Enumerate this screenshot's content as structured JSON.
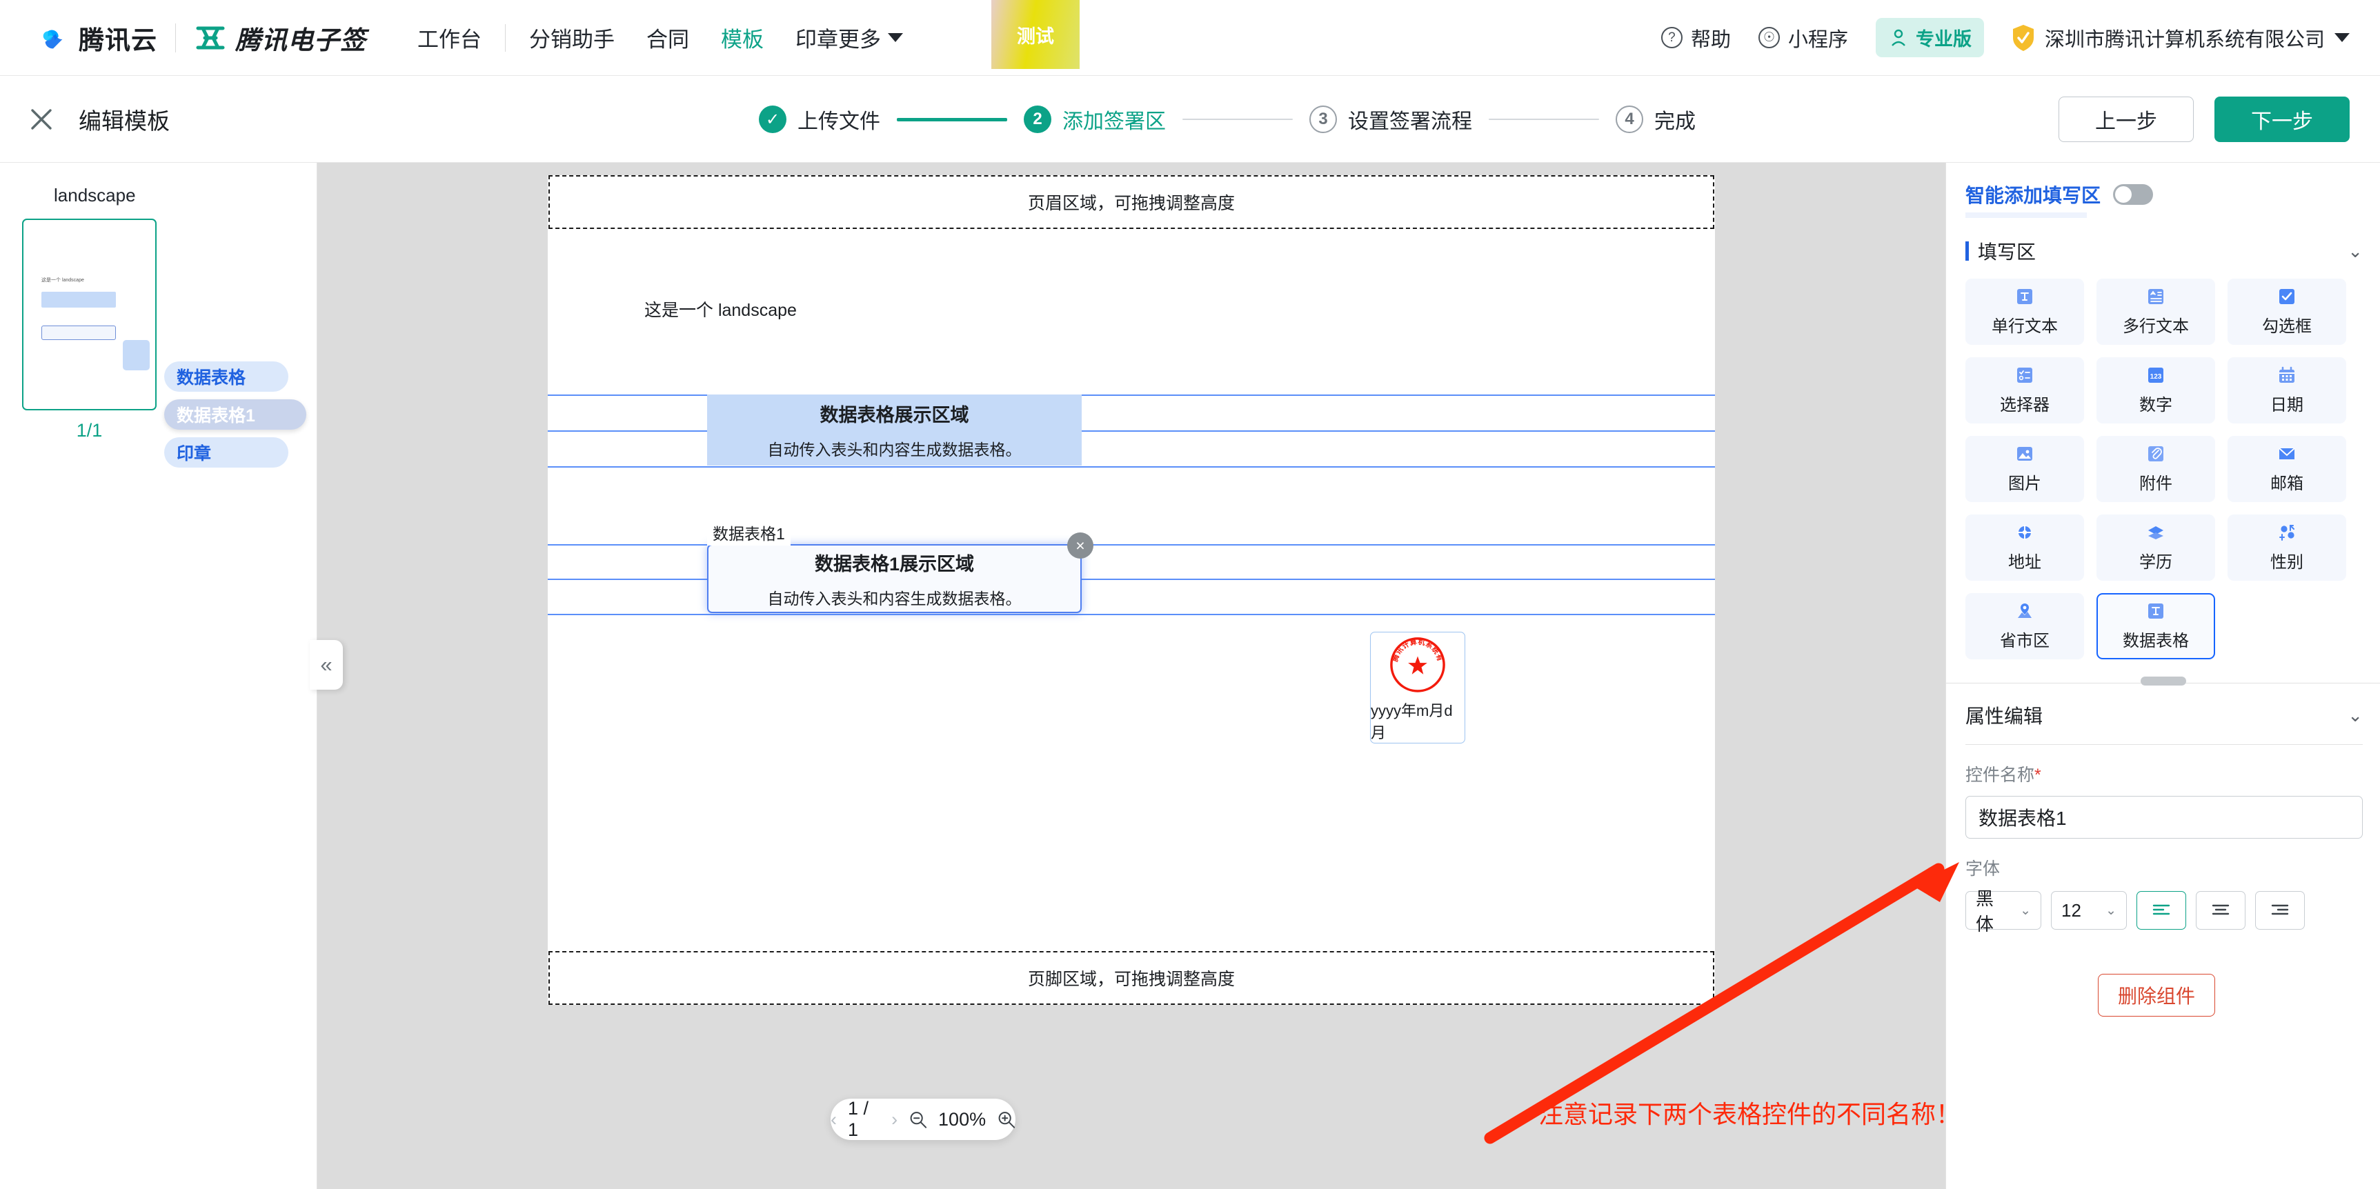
{
  "topnav": {
    "brand_cloud": "腾讯云",
    "brand_esign": "腾讯电子签",
    "workbench": "工作台",
    "items": [
      {
        "label": "分销助手",
        "active": false
      },
      {
        "label": "合同",
        "active": false
      },
      {
        "label": "模板",
        "active": true
      },
      {
        "label": "印章",
        "active": false
      }
    ],
    "more": "更多",
    "test_tab": "测试",
    "help": "帮助",
    "miniprogram": "小程序",
    "pro_badge": "专业版",
    "company": "深圳市腾讯计算机系统有限公司"
  },
  "subheader": {
    "title": "编辑模板",
    "steps": [
      {
        "num": "1",
        "label": "上传文件",
        "state": "done"
      },
      {
        "num": "2",
        "label": "添加签署区",
        "state": "active"
      },
      {
        "num": "3",
        "label": "设置签署流程",
        "state": "idle"
      },
      {
        "num": "4",
        "label": "完成",
        "state": "idle"
      }
    ],
    "prev_label": "上一步",
    "next_label": "下一步"
  },
  "leftpanel": {
    "doc_name": "landscape",
    "page_indicator": "1/1",
    "thumb_text": "这是一个 landscape",
    "chips": [
      {
        "label": "数据表格",
        "selected": false
      },
      {
        "label": "数据表格1",
        "selected": true
      },
      {
        "label": "印章",
        "selected": false
      }
    ]
  },
  "canvas": {
    "header_zone": "页眉区域，可拖拽调整高度",
    "footer_zone": "页脚区域，可拖拽调整高度",
    "body_text": "这是一个 landscape",
    "widget_a": {
      "title": "数据表格展示区域",
      "subtitle": "自动传入表头和内容生成数据表格。"
    },
    "widget_b": {
      "tag": "数据表格1",
      "title": "数据表格1展示区域",
      "subtitle": "自动传入表头和内容生成数据表格。",
      "close": "×"
    },
    "seal": {
      "company_text": "深圳市腾讯计算机系统有限公司",
      "date_placeholder": "yyyy年m月d月"
    },
    "zoombar": {
      "prev": "‹",
      "page": "1 / 1",
      "next": "›",
      "zoom_level": "100%"
    }
  },
  "rightpanel": {
    "smart_label": "智能添加填写区",
    "smart_toggle_on": false,
    "section_title": "填写区",
    "tiles": [
      {
        "label": "单行文本",
        "icon": "single-line-text-icon",
        "selected": false
      },
      {
        "label": "多行文本",
        "icon": "multi-line-text-icon",
        "selected": false
      },
      {
        "label": "勾选框",
        "icon": "checkbox-icon",
        "selected": false
      },
      {
        "label": "选择器",
        "icon": "selector-icon",
        "selected": false
      },
      {
        "label": "数字",
        "icon": "number-icon",
        "selected": false
      },
      {
        "label": "日期",
        "icon": "date-icon",
        "selected": false
      },
      {
        "label": "图片",
        "icon": "image-icon",
        "selected": false
      },
      {
        "label": "附件",
        "icon": "attachment-icon",
        "selected": false
      },
      {
        "label": "邮箱",
        "icon": "email-icon",
        "selected": false
      },
      {
        "label": "地址",
        "icon": "address-icon",
        "selected": false
      },
      {
        "label": "学历",
        "icon": "education-icon",
        "selected": false
      },
      {
        "label": "性别",
        "icon": "gender-icon",
        "selected": false
      },
      {
        "label": "省市区",
        "icon": "region-icon",
        "selected": false
      },
      {
        "label": "数据表格",
        "icon": "data-table-icon",
        "selected": true
      }
    ],
    "prop_title": "属性编辑",
    "name_label": "控件名称",
    "name_required": "*",
    "name_value": "数据表格1",
    "font_label": "字体",
    "font_family": "黑体",
    "font_size": "12",
    "align_active": "left",
    "delete_label": "删除组件"
  },
  "annotation": {
    "text": "注意记录下两个表格控件的不同名称！",
    "color": "#fd2a0b"
  }
}
